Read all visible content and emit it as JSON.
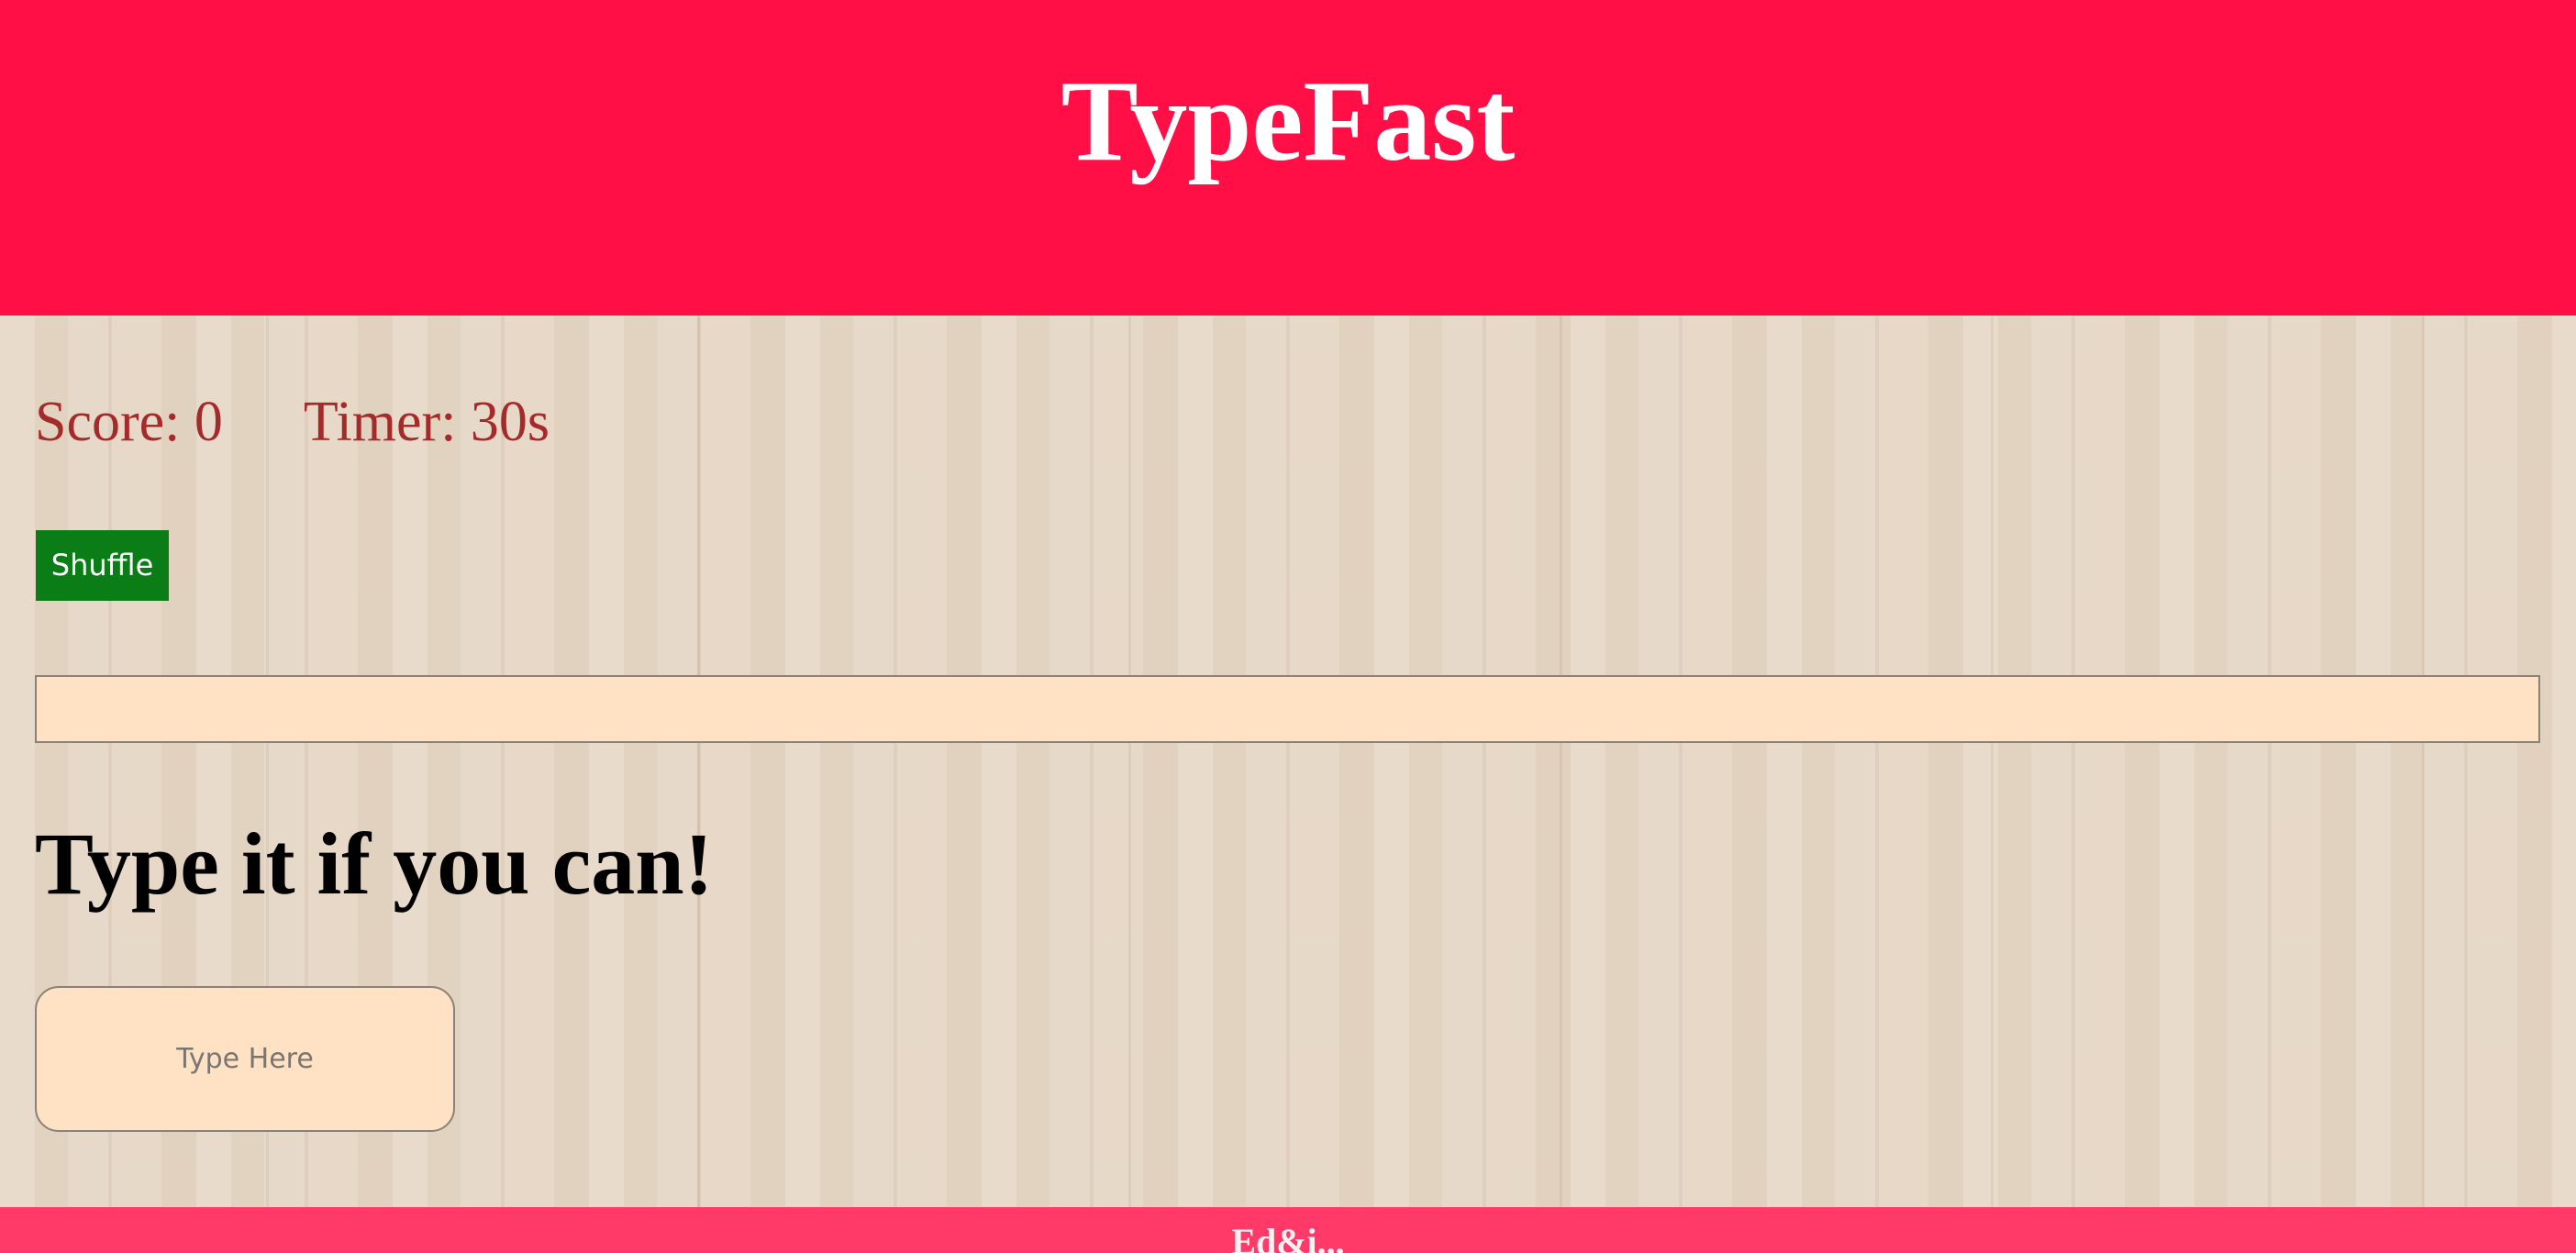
{
  "header": {
    "title": "TypeFast"
  },
  "stats": {
    "score_label": "Score: 0",
    "timer_label": "Timer: 30s"
  },
  "controls": {
    "shuffle_label": "Shuffle"
  },
  "word_display": {
    "value": ""
  },
  "prompt": {
    "heading": "Type it if you can!"
  },
  "input": {
    "placeholder": "Type Here",
    "value": ""
  },
  "footer": {
    "text": "Ed&i..."
  },
  "colors": {
    "header_bg": "#ff0f45",
    "footer_bg": "#ff3a68",
    "stats_text": "#a52a2a",
    "shuffle_bg": "#0a7d17",
    "field_bg": "#ffe2c4"
  }
}
